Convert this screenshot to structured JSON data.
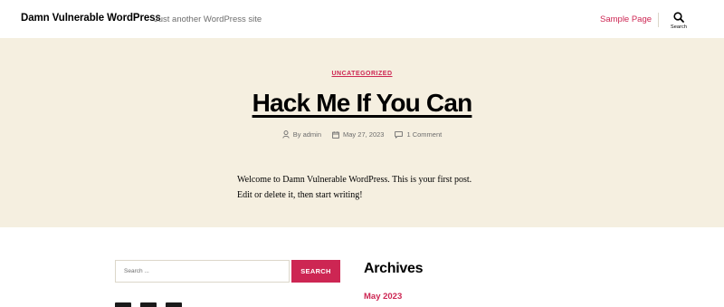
{
  "header": {
    "site_title": "Damn Vulnerable WordPress",
    "site_description": "Just another WordPress site",
    "nav": [
      {
        "label": "Sample Page"
      }
    ],
    "search_toggle_label": "Search"
  },
  "post": {
    "category": "UNCATEGORIZED",
    "title": "Hack Me If You Can",
    "meta": {
      "author": "By admin",
      "date": "May 27, 2023",
      "comments": "1 Comment"
    },
    "content": "Welcome to Damn Vulnerable WordPress. This is your first post. Edit or delete it, then start writing!"
  },
  "widgets": {
    "search": {
      "placeholder": "Search ...",
      "button_label": "SEARCH"
    },
    "archives": {
      "title": "Archives",
      "items": [
        "May 2023"
      ]
    }
  },
  "colors": {
    "accent": "#cd2653",
    "band_background": "#f5efe0",
    "meta_text": "#6d6d6d"
  },
  "icons": {
    "search": "search-icon",
    "author": "user-icon",
    "date": "calendar-icon",
    "comments": "comment-icon"
  }
}
